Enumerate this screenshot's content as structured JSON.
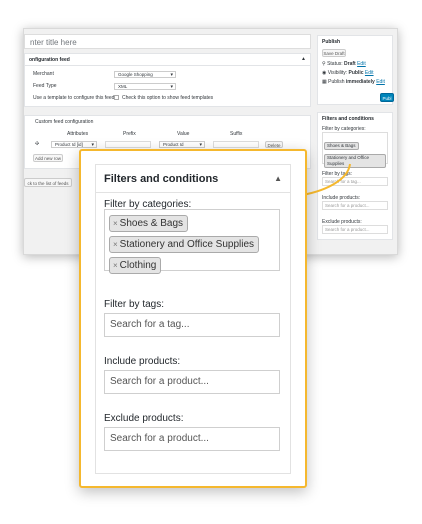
{
  "admin": {
    "title_placeholder": "nter title here",
    "config": {
      "heading": "onfiguration feed",
      "merchant_label": "Merchant",
      "merchant_value": "Google Shopping",
      "feed_type_label": "Feed Type",
      "feed_type_value": "XML",
      "template_label": "Use a template to configure this feed",
      "template_checkbox_label": "Check this option to show feed templates"
    },
    "custom": {
      "heading": "Custom feed configuration",
      "columns": [
        "Attributes",
        "Prefix",
        "Value",
        "Suffix"
      ],
      "row_attribute": "Product Id [id]",
      "row_value": "Product Id",
      "delete_label": "Delete",
      "add_row_label": "Add new row",
      "back_label": "ck to the list of feeds"
    },
    "publish": {
      "heading": "Publish",
      "save_draft": "Save Draft",
      "status_label": "Status:",
      "status_value": "Draft",
      "visibility_label": "Visibility:",
      "visibility_value": "Public",
      "publish_label": "Publish",
      "publish_value": "immediately",
      "edit": "Edit",
      "publish_button": "Publ"
    },
    "filters_small": {
      "heading": "Filters and conditions",
      "categories_label": "Filter by categories:",
      "tags": [
        "Shoes & Bags",
        "Stationery and Office Supplies",
        "Clothing"
      ],
      "tags_label": "Filter by tags:",
      "tag_placeholder": "Search for a tag...",
      "include_label": "Include products:",
      "include_placeholder": "Search for a product...",
      "exclude_label": "Exclude products:",
      "exclude_placeholder": "Search for a product..."
    }
  },
  "zoom": {
    "heading": "Filters and conditions",
    "categories_label": "Filter by categories:",
    "tags": [
      "Shoes & Bags",
      "Stationery and Office Supplies",
      "Clothing"
    ],
    "tag_remove_icon": "×",
    "tags_label": "Filter by tags:",
    "tag_placeholder": "Search for a tag...",
    "include_label": "Include products:",
    "include_placeholder": "Search for a product...",
    "exclude_label": "Exclude products:",
    "exclude_placeholder": "Search for a product..."
  },
  "colors": {
    "highlight": "#f5b82e",
    "primary": "#0085ba",
    "link": "#0073aa"
  }
}
